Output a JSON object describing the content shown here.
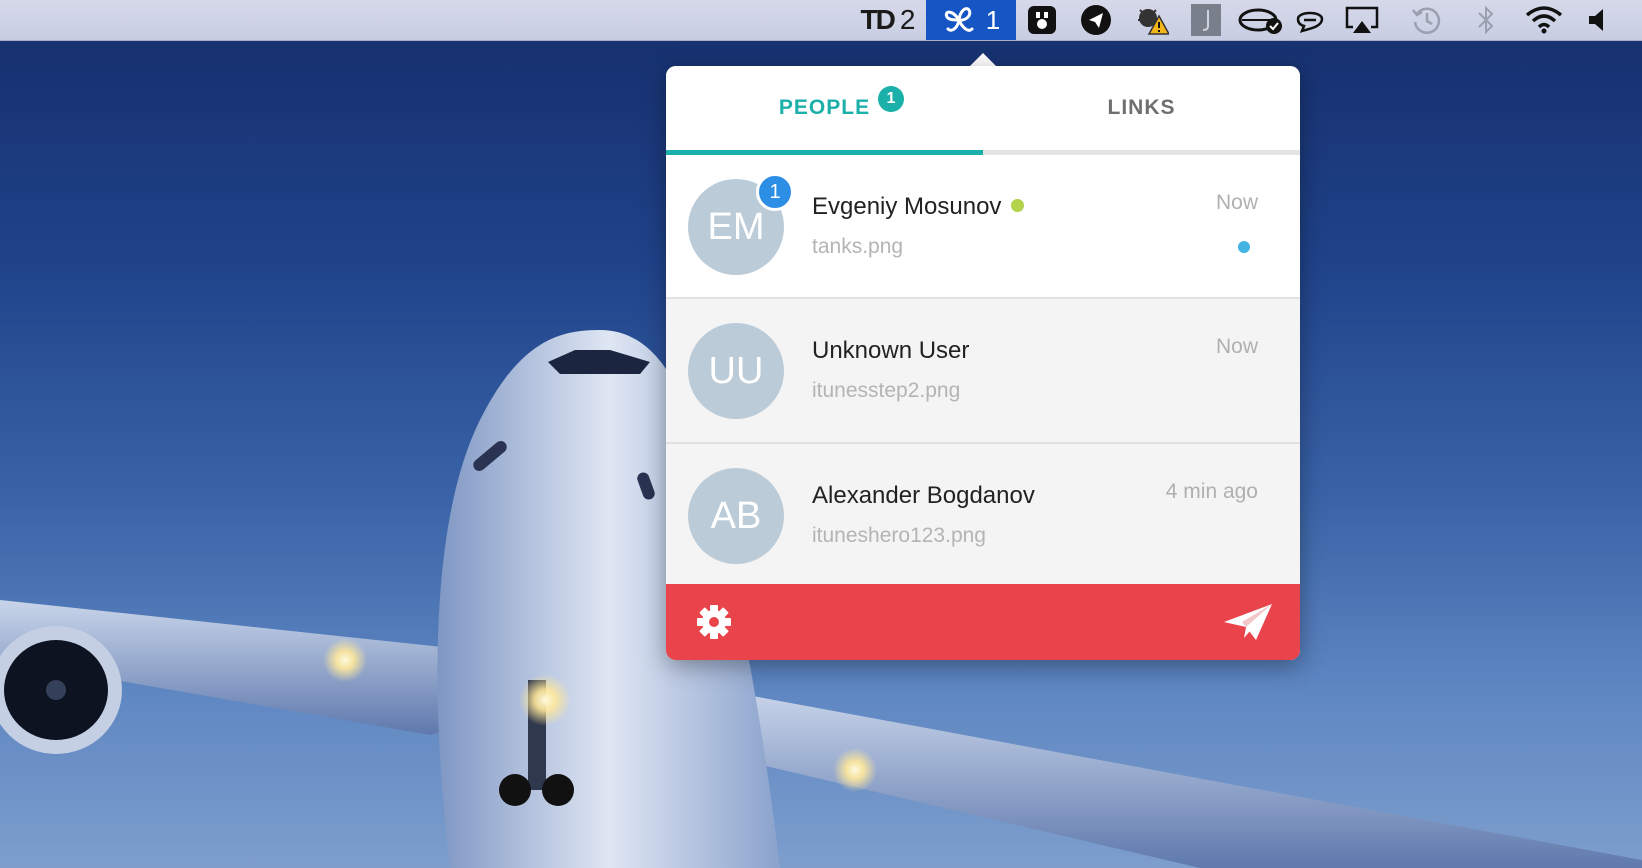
{
  "menubar": {
    "td_label": "TD",
    "td_count": "2",
    "active_count": "1",
    "icons": [
      "tweetdeck-icon",
      "droplr-icon",
      "bartender-icon",
      "telegram-icon",
      "bug-warning-icon",
      "j-app-icon",
      "cloud-sync-icon",
      "chat-bubble-icon",
      "airplay-icon",
      "time-machine-icon",
      "bluetooth-icon",
      "wifi-icon",
      "volume-icon"
    ],
    "active_color": "#1556c4"
  },
  "tabs": {
    "people_label": "PEOPLE",
    "people_badge": "1",
    "links_label": "LINKS",
    "active_color": "#1bb1aa"
  },
  "people": [
    {
      "initials": "EM",
      "badge": "1",
      "name": "Evgeniy Mosunov",
      "online": true,
      "file": "tanks.png",
      "time": "Now",
      "unread": true
    },
    {
      "initials": "UU",
      "name": "Unknown User",
      "file": "itunesstep2.png",
      "time": "Now"
    },
    {
      "initials": "AB",
      "name": "Alexander Bogdanov",
      "file": "ituneshero123.png",
      "time": "4 min ago"
    }
  ],
  "footer": {
    "color": "#e9444b",
    "left_icon": "gear-icon",
    "right_icon": "paper-plane-icon"
  }
}
